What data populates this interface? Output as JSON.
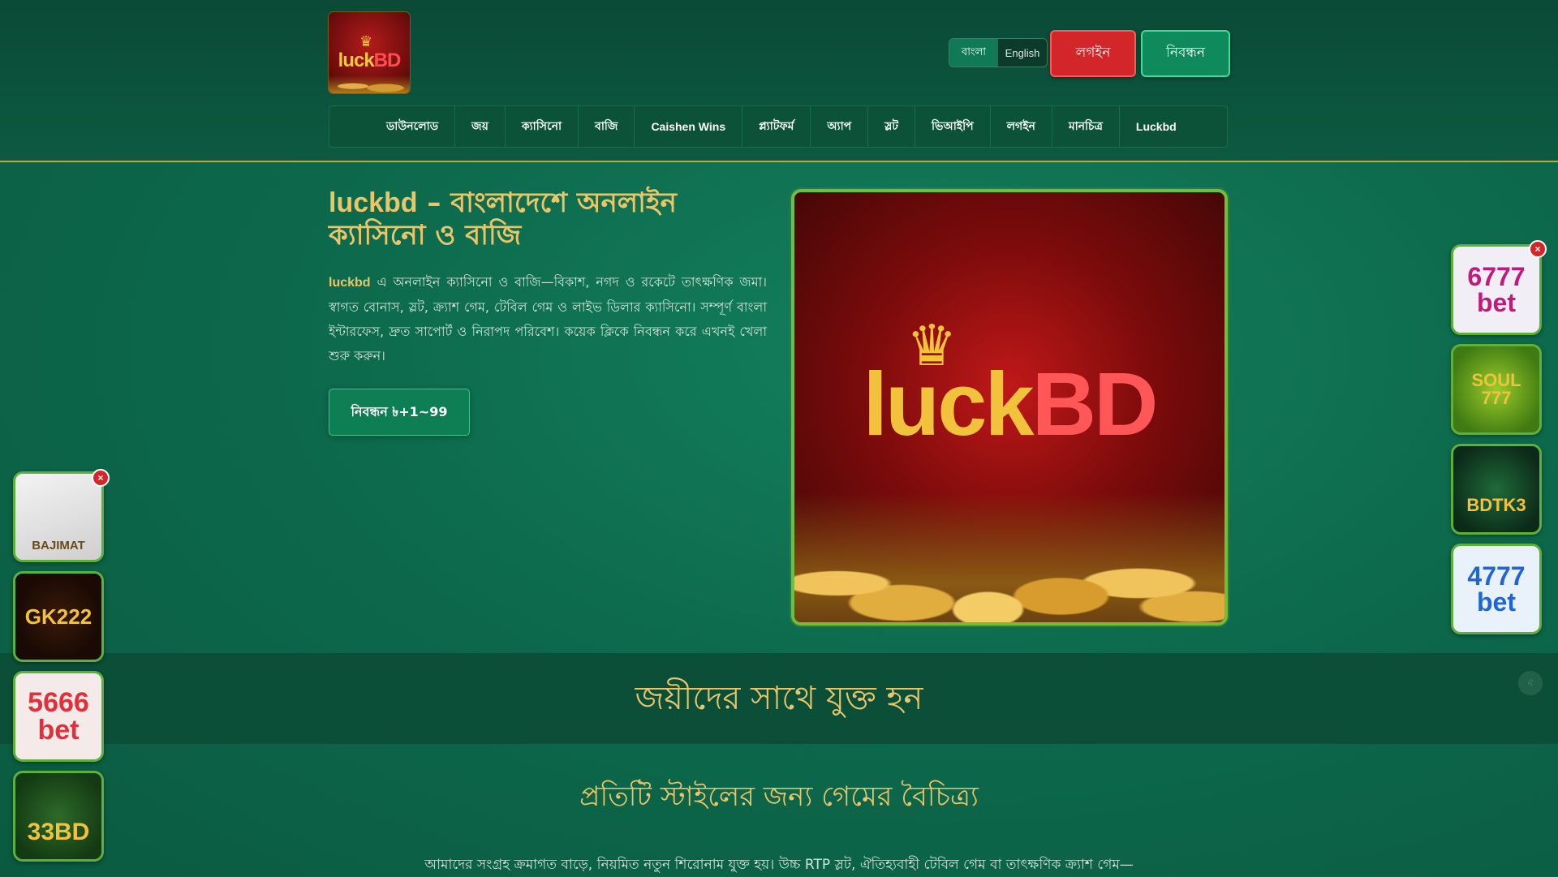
{
  "header": {
    "logo": {
      "brand_a": "luck",
      "brand_b": "BD"
    },
    "language": {
      "options": [
        "বাংলা",
        "English"
      ],
      "selected": "বাংলা"
    },
    "login_label": "লগইন",
    "register_label": "নিবন্ধন"
  },
  "nav": {
    "items": [
      "ডাউনলোড",
      "জয়",
      "ক্যাসিনো",
      "বাজি",
      "Caishen Wins",
      "প্ল্যাটফর্ম",
      "অ্যাপ",
      "স্লট",
      "ভিআইপি",
      "লগইন",
      "মানচিত্র",
      "Luckbd"
    ]
  },
  "hero": {
    "title_brand": "luckbd",
    "title_rest": " – বাংলাদেশে অনলাইন ক্যাসিনো ও বাজি",
    "text_brand": "luckbd",
    "text_rest": " এ অনলাইন ক্যাসিনো ও বাজি—বিকাশ, নগদ ও রকেটে তাৎক্ষণিক জমা। স্বাগত বোনাস, স্লট, ক্র্যাশ গেম, টেবিল গেম ও লাইভ ডিলার ক্যাসিনো। সম্পূর্ণ বাংলা ইন্টারফেস, দ্রুত সাপোর্ট ও নিরাপদ পরিবেশ। কয়েক ক্লিকে নিবন্ধন করে এখনই খেলা শুরু করুন।",
    "cta_label": "নিবন্ধন ৳+1~99",
    "image": {
      "brand_a": "luck",
      "brand_b": "BD"
    }
  },
  "band": {
    "title": "জয়ীদের সাথে যুক্ত হন"
  },
  "section": {
    "title": "প্রতিটি স্টাইলের জন্য গেমের বৈচিত্র্য",
    "text": "আমাদের সংগ্রহ ক্রমাগত বাড়ে, নিয়মিত নতুন শিরোনাম যুক্ত হয়। উচ্চ RTP স্লট, ঐতিহ্যবাহী টেবিল গেম বা তাৎক্ষণিক ক্র্যাশ গেম—"
  },
  "ads_left": [
    "BAJIMAT",
    "GK222",
    "5666 bet",
    "33BD"
  ],
  "ads_right": [
    "6777 bet",
    "SOUL 777",
    "BDTK3",
    "4777 bet"
  ],
  "close_label": "×",
  "colors": {
    "accent_gold": "#e9c66a",
    "login_red": "#d3262a",
    "register_green": "#0f8a5c",
    "background": "#0d6a4c"
  }
}
